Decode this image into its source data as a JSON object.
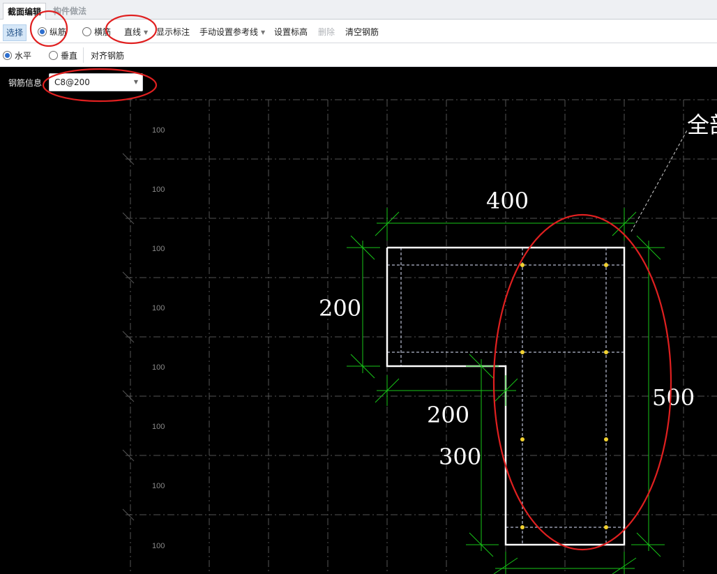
{
  "tabs": [
    {
      "label": "截面编辑"
    },
    {
      "label": "构件做法"
    }
  ],
  "toolbar1": {
    "select": "选择",
    "longitudinal": "纵筋",
    "transverse": "横筋",
    "line_mode": "直线",
    "show_dims": "显示标注",
    "manual_ref": "手动设置参考线",
    "set_elev": "设置标高",
    "delete": "删除",
    "clear_rebar": "清空钢筋"
  },
  "toolbar2": {
    "horizontal": "水平",
    "vertical": "垂直",
    "align_rebar": "对齐钢筋"
  },
  "rebar_info": {
    "label": "钢筋信息",
    "value": "C8@200"
  },
  "canvas": {
    "grid_labels": [
      "100",
      "100",
      "100",
      "100",
      "100",
      "100",
      "100",
      "100"
    ],
    "dimensions": {
      "top": "400",
      "left_upper": "200",
      "left_lower_horizontal": "200",
      "left_lower_vertical": "300",
      "right": "500"
    },
    "annotation_text": "全部"
  },
  "colors": {
    "canvas_bg": "#000000",
    "section_outline": "#ffffff",
    "dim_lines": "#17c617",
    "rebar_points": "#f2d230",
    "highlight": "#e02020"
  }
}
